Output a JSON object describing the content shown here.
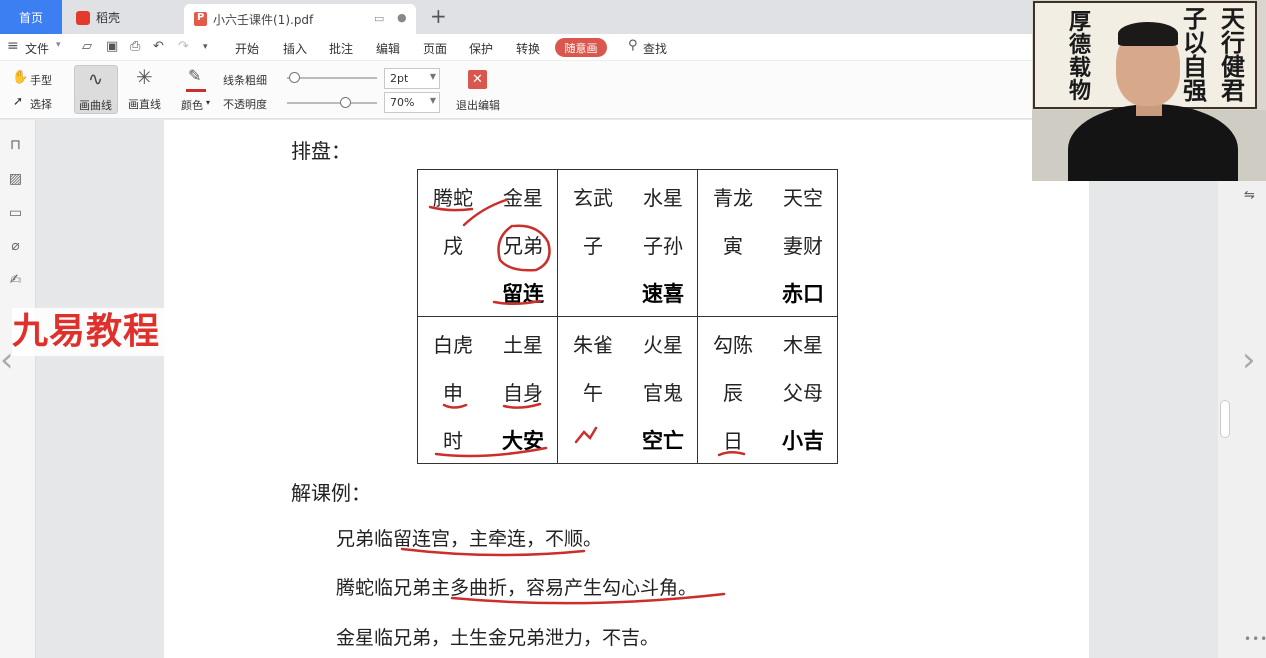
{
  "tabs": {
    "home": "首页",
    "draft": "稻壳",
    "document": "小六壬课件(1).pdf"
  },
  "menu": {
    "file": "文件",
    "items": [
      "开始",
      "插入",
      "批注",
      "编辑",
      "页面",
      "保护",
      "转换"
    ],
    "highlight": "随意画",
    "search": "查找"
  },
  "ribbon": {
    "hand": "手型",
    "select": "选择",
    "curve": "画曲线",
    "straight": "画直线",
    "color": "颜色",
    "thickness_label": "线条粗细",
    "opacity_label": "不透明度",
    "thickness_value": "2pt",
    "opacity_value": "70%",
    "exit": "退出编辑"
  },
  "watermark": "九易教程",
  "page": {
    "heading_paipan": "排盘：",
    "heading_example": "解课例：",
    "grid": [
      [
        {
          "r1": [
            "腾蛇",
            "金星"
          ],
          "r2": [
            "戌",
            "兄弟"
          ],
          "r3": [
            "",
            "留连"
          ]
        },
        {
          "r1": [
            "玄武",
            "水星"
          ],
          "r2": [
            "子",
            "子孙"
          ],
          "r3": [
            "",
            "速喜"
          ]
        },
        {
          "r1": [
            "青龙",
            "天空"
          ],
          "r2": [
            "寅",
            "妻财"
          ],
          "r3": [
            "",
            "赤口"
          ]
        }
      ],
      [
        {
          "r1": [
            "白虎",
            "土星"
          ],
          "r2": [
            "申",
            "自身"
          ],
          "r3": [
            "时",
            "大安"
          ]
        },
        {
          "r1": [
            "朱雀",
            "火星"
          ],
          "r2": [
            "午",
            "官鬼"
          ],
          "r3": [
            "",
            "空亡"
          ]
        },
        {
          "r1": [
            "勾陈",
            "木星"
          ],
          "r2": [
            "辰",
            "父母"
          ],
          "r3": [
            "日",
            "小吉"
          ]
        }
      ]
    ],
    "lines": [
      "兄弟临留连宫，主牵连，不顺。",
      "腾蛇临兄弟主多曲折，容易产生勾心斗角。",
      "金星临兄弟，土生金兄弟泄力，不吉。"
    ]
  },
  "webcam": {
    "calligraphy": [
      "天行健君",
      "子以自强",
      "厚德载物"
    ]
  },
  "colors": {
    "accent": "#3b7ff2",
    "ink": "#c9302c",
    "highlight": "#d9574c"
  }
}
